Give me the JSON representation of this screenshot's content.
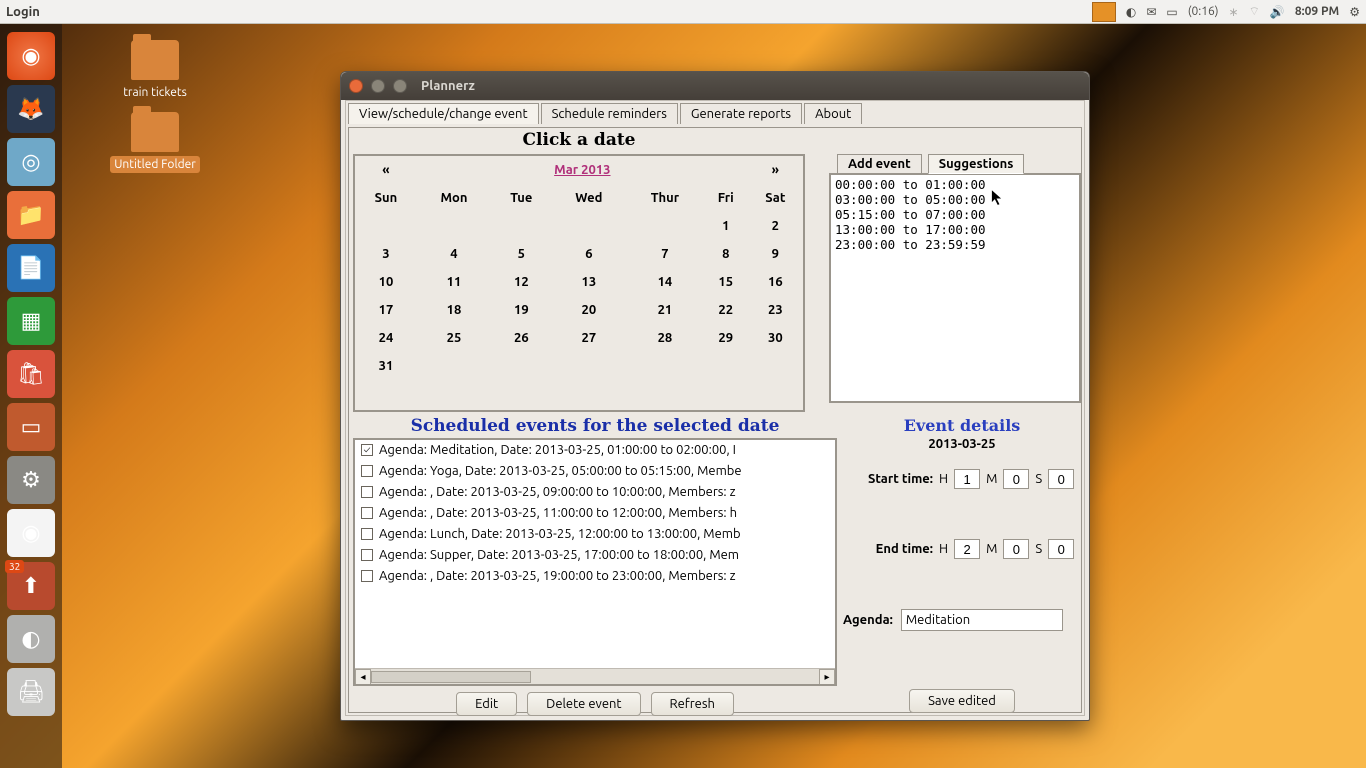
{
  "panel": {
    "menu_label": "Login",
    "battery": "(0:16)",
    "clock": "8:09 PM"
  },
  "desktop": {
    "train": "train tickets",
    "untitled": "Untitled Folder"
  },
  "window": {
    "title": "Plannerz",
    "tabs": [
      "View/schedule/change event",
      "Schedule reminders",
      "Generate reports",
      "About"
    ],
    "click_a_date": "Click a date",
    "calendar": {
      "prev": "«",
      "next": "»",
      "month": "Mar 2013",
      "dow": [
        "Sun",
        "Mon",
        "Tue",
        "Wed",
        "Thur",
        "Fri",
        "Sat"
      ],
      "grid": [
        [
          "",
          "",
          "",
          "",
          "",
          "1",
          "2"
        ],
        [
          "3",
          "4",
          "5",
          "6",
          "7",
          "8",
          "9"
        ],
        [
          "10",
          "11",
          "12",
          "13",
          "14",
          "15",
          "16"
        ],
        [
          "17",
          "18",
          "19",
          "20",
          "21",
          "22",
          "23"
        ],
        [
          "24",
          "25",
          "26",
          "27",
          "28",
          "29",
          "30"
        ],
        [
          "31",
          "",
          "",
          "",
          "",
          "",
          ""
        ]
      ]
    },
    "side_tabs": {
      "add": "Add event",
      "sugg": "Suggestions"
    },
    "suggestions": [
      "00:00:00 to 01:00:00",
      "03:00:00 to 05:00:00",
      "05:15:00 to 07:00:00",
      "13:00:00 to 17:00:00",
      "23:00:00 to 23:59:59"
    ],
    "events_title": "Scheduled events for the selected date",
    "events": [
      {
        "checked": true,
        "text": "Agenda: Meditation, Date: 2013-03-25, 01:00:00 to 02:00:00, I"
      },
      {
        "checked": false,
        "text": "Agenda: Yoga, Date: 2013-03-25, 05:00:00 to 05:15:00, Membe"
      },
      {
        "checked": false,
        "text": "Agenda: , Date: 2013-03-25, 09:00:00 to 10:00:00, Members: z"
      },
      {
        "checked": false,
        "text": "Agenda: , Date: 2013-03-25, 11:00:00 to 12:00:00, Members: h"
      },
      {
        "checked": false,
        "text": "Agenda: Lunch, Date: 2013-03-25, 12:00:00 to 13:00:00, Memb"
      },
      {
        "checked": false,
        "text": "Agenda: Supper, Date: 2013-03-25, 17:00:00 to 18:00:00, Mem"
      },
      {
        "checked": false,
        "text": "Agenda: , Date: 2013-03-25, 19:00:00 to 23:00:00, Members: z"
      }
    ],
    "buttons": {
      "edit": "Edit",
      "delete": "Delete event",
      "refresh": "Refresh",
      "save": "Save edited"
    },
    "details": {
      "title": "Event details",
      "date": "2013-03-25",
      "start_label": "Start time:",
      "end_label": "End time:",
      "H": "H",
      "M": "M",
      "S": "S",
      "start": {
        "h": "1",
        "m": "0",
        "s": "0"
      },
      "end": {
        "h": "2",
        "m": "0",
        "s": "0"
      },
      "agenda_label": "Agenda:",
      "agenda_value": "Meditation"
    }
  }
}
